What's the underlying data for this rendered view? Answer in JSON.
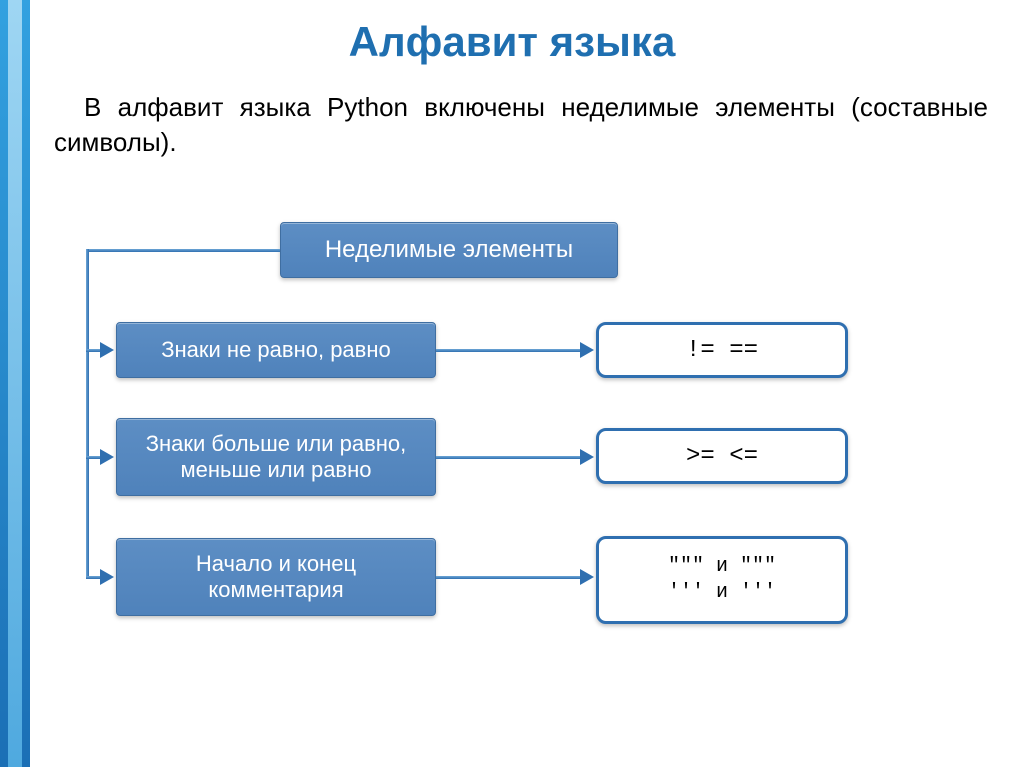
{
  "title": "Алфавит языка",
  "paragraph": "В алфавит языка Python включены неделимые элементы (составные символы).",
  "diagram": {
    "root": "Неделимые элементы",
    "rows": [
      {
        "label": "Знаки не равно, равно",
        "symbols": "!=   =="
      },
      {
        "label": "Знаки больше или равно, меньше или равно",
        "symbols": ">=  <="
      },
      {
        "label": "Начало и конец комментария",
        "symbols": "\"\"\" и \"\"\"\n''' и '''"
      }
    ]
  }
}
